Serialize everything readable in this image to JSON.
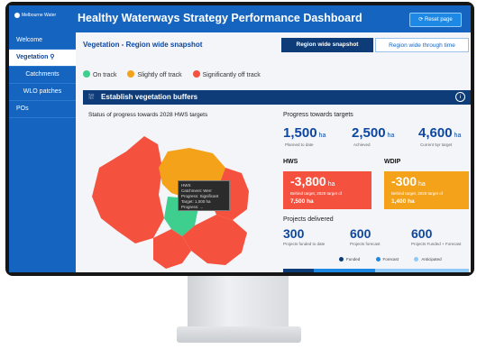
{
  "app": {
    "logo_text": "Melbourne Water",
    "title": "Healthy Waterways Strategy Performance Dashboard",
    "reset_label": "Reset page"
  },
  "sidebar": {
    "items": [
      {
        "label": "Welcome"
      },
      {
        "label": "Vegetation"
      },
      {
        "label": "Catchments"
      },
      {
        "label": "WLO patches"
      },
      {
        "label": "POs"
      }
    ]
  },
  "main": {
    "subheading": "Vegetation - Region wide snapshot",
    "toggle": {
      "on": "Region wide snapshot",
      "off": "Region wide through time"
    },
    "legend": [
      {
        "label": "On track",
        "color": "#3ecf8e"
      },
      {
        "label": "Slightly off track",
        "color": "#f5a21b"
      },
      {
        "label": "Significantly off track",
        "color": "#f4513f"
      }
    ],
    "section_title": "Establish vegetation buffers",
    "left_title": "Status of progress towards 2028 HWS targets",
    "tooltip": [
      "HWS",
      "Catchment: Werr",
      "Progress: Significant",
      "Target: 1,000 ha",
      "Progress: ..."
    ],
    "right_title": "Progress towards targets",
    "stats": [
      {
        "value": "1,500",
        "unit": "ha",
        "label": "Planned to date"
      },
      {
        "value": "2,500",
        "unit": "ha",
        "label": "Achieved"
      },
      {
        "value": "4,600",
        "unit": "ha",
        "label": "Current 5yr target"
      }
    ],
    "hws": {
      "heading": "HWS",
      "value": "-3,800",
      "unit": "ha",
      "sub": "Behind target, 2028 target of",
      "sub2": "7,500 ha"
    },
    "wdip": {
      "heading": "WDIP",
      "value": "-300",
      "unit": "ha",
      "sub": "Behind target, 2028 target of",
      "sub2": "1,400 ha"
    },
    "projects_title": "Projects delivered",
    "projects": [
      {
        "value": "300",
        "label": "Projects funded to date"
      },
      {
        "value": "600",
        "label": "Projects forecast"
      },
      {
        "value": "600",
        "label": "Projects Funded + Forecast"
      }
    ],
    "mini_legend": [
      "Funded",
      "Forecast",
      "Anticipated"
    ]
  }
}
